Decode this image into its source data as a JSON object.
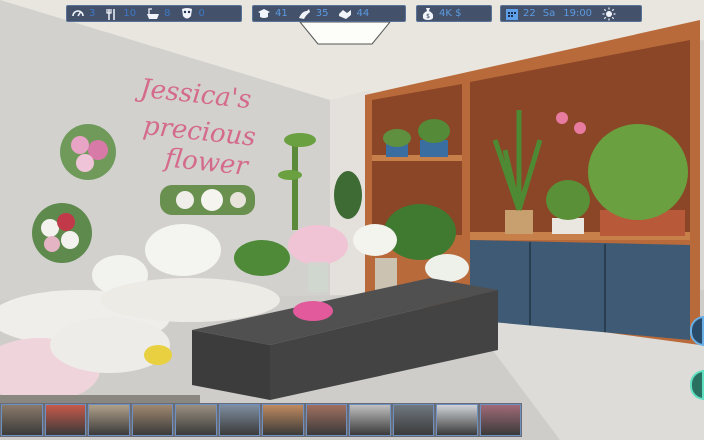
{
  "hud": {
    "needs": [
      {
        "icon": "mood-icon",
        "value": "3"
      },
      {
        "icon": "food-icon",
        "value": "10"
      },
      {
        "icon": "hygiene-icon",
        "value": "8"
      },
      {
        "icon": "mask-icon",
        "value": "0"
      }
    ],
    "skills": [
      {
        "icon": "education-icon",
        "value": "41"
      },
      {
        "icon": "fitness-icon",
        "value": "35"
      },
      {
        "icon": "social-icon",
        "value": "44"
      }
    ],
    "money": {
      "icon": "money-bag-icon",
      "value": "4K $"
    },
    "time": {
      "icon": "calendar-icon",
      "day_number": "22",
      "weekday": "Sa",
      "clock": "19:00",
      "weather_icon": "sun-icon"
    }
  },
  "scene": {
    "wall_sign": [
      "Jessica's",
      "precious",
      "flower"
    ],
    "colors": {
      "sign": "#d46a8c",
      "counter_vase": "#e25a9c",
      "hud_panel": "#1e3050",
      "hud_value": "#3f78c4"
    }
  },
  "locations": [
    {
      "name": "location-thumbnail-1",
      "color": "#8a7a6a"
    },
    {
      "name": "location-thumbnail-2",
      "color": "#c75a4a"
    },
    {
      "name": "location-thumbnail-3",
      "color": "#b0a08a"
    },
    {
      "name": "location-thumbnail-4",
      "color": "#a08870"
    },
    {
      "name": "location-thumbnail-5",
      "color": "#9a8f80"
    },
    {
      "name": "location-thumbnail-6",
      "color": "#7f8ea0"
    },
    {
      "name": "location-thumbnail-7",
      "color": "#c08a60"
    },
    {
      "name": "location-thumbnail-8",
      "color": "#a07060"
    },
    {
      "name": "location-thumbnail-9",
      "color": "#c0c0c0"
    },
    {
      "name": "location-thumbnail-10",
      "color": "#707880"
    },
    {
      "name": "location-thumbnail-11",
      "color": "#d0d4d8"
    },
    {
      "name": "location-thumbnail-12",
      "color": "#a06a78"
    }
  ]
}
